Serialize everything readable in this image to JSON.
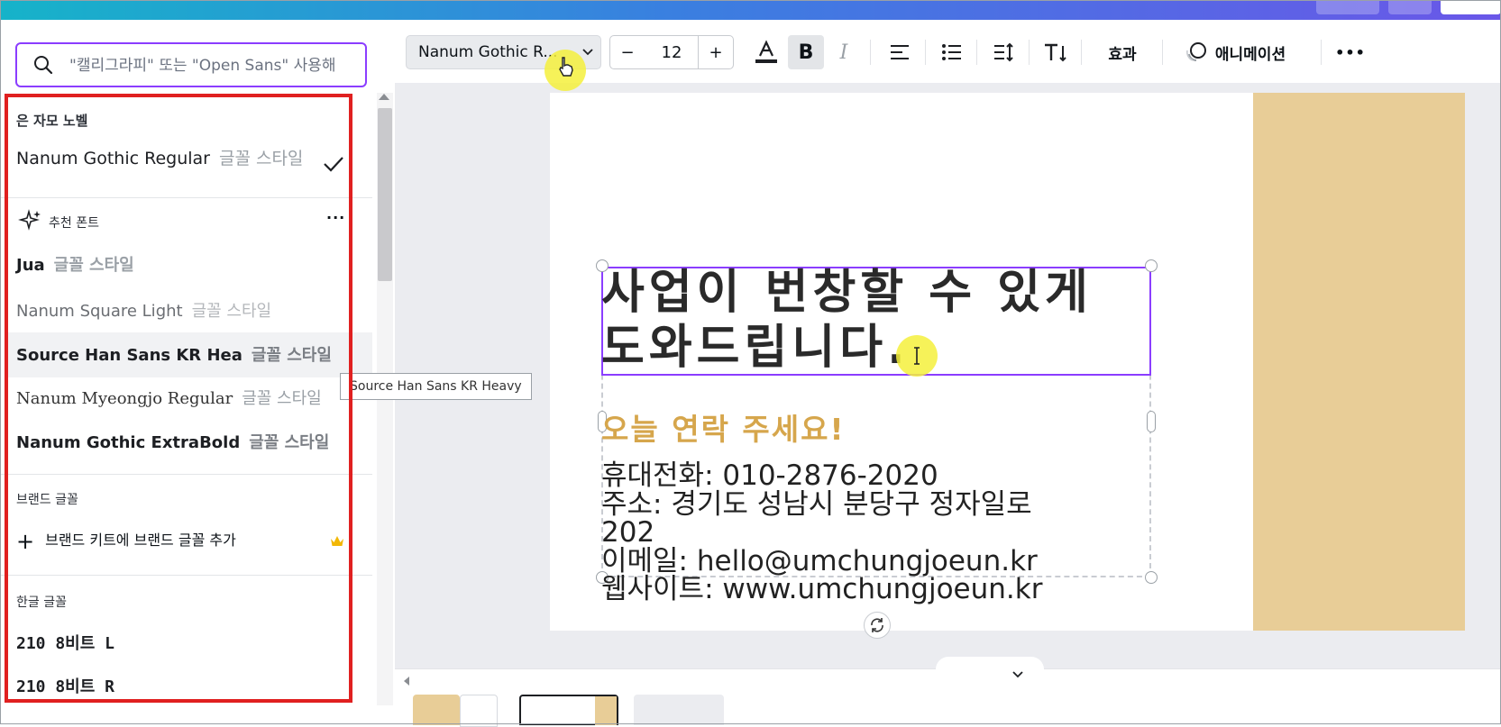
{
  "search": {
    "placeholder": "\"캘리그라피\" 또는 \"Open Sans\" 사용해"
  },
  "font_panel": {
    "current_header": "은 자모 노벨",
    "current_font": {
      "name": "Nanum Gothic Regular",
      "sample": "글꼴 스타일"
    },
    "recommended_title": "추천 폰트",
    "recommended": [
      {
        "name": "Jua",
        "sample": "글꼴 스타일"
      },
      {
        "name": "Nanum Square Light",
        "sample": "글꼴 스타일"
      },
      {
        "name": "Source Han Sans KR Hea",
        "sample": "글꼴 스타일"
      },
      {
        "name": "Nanum Myeongjo Regular",
        "sample": "글꼴 스타일"
      },
      {
        "name": "Nanum Gothic ExtraBold",
        "sample": "글꼴 스타일"
      }
    ],
    "brand_title": "브랜드 글꼴",
    "brand_add": "브랜드 키트에 브랜드 글꼴 추가",
    "korean_title": "한글 글꼴",
    "korean": [
      {
        "name": "210 8비트 L"
      },
      {
        "name": "210 8비트 R"
      }
    ]
  },
  "tooltip": "Source Han Sans KR Heavy",
  "toolbar": {
    "font_name": "Nanum Gothic R...",
    "font_size": "12",
    "minus": "−",
    "plus": "+",
    "bold": "B",
    "italic": "I",
    "effects": "효과",
    "animation": "애니메이션",
    "more": "•••"
  },
  "canvas": {
    "headline_line1": "사업이 번창할 수 있게",
    "headline_line2": "도와드립니다.",
    "subheading": "오늘 연락 주세요!",
    "phone": "휴대전화: 010-2876-2020",
    "address_line1": "주소: 경기도 성남시 분당구 정자일로",
    "address_line2": "202",
    "email": "이메일: hello@umchungjoeun.kr",
    "website": "웹사이트: www.umchungjoeun.kr"
  },
  "colors": {
    "accent_purple": "#8b3dff",
    "highlight_red": "#e02020",
    "gold_panel": "#e8cd97",
    "subheading_gold": "#d6a64c"
  }
}
